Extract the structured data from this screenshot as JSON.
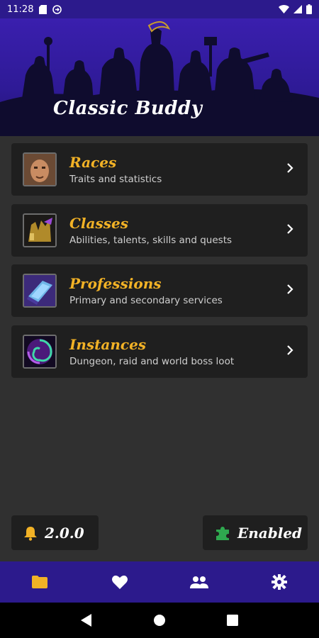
{
  "status_bar": {
    "time": "11:28"
  },
  "header": {
    "title": "Classic Buddy"
  },
  "menu": [
    {
      "title": "Races",
      "subtitle": "Traits and statistics",
      "icon": "race-portrait-icon"
    },
    {
      "title": "Classes",
      "subtitle": "Abilities, talents, skills and quests",
      "icon": "class-icon"
    },
    {
      "title": "Professions",
      "subtitle": "Primary and secondary services",
      "icon": "profession-icon"
    },
    {
      "title": "Instances",
      "subtitle": "Dungeon, raid and world boss loot",
      "icon": "instance-portal-icon"
    }
  ],
  "footer": {
    "version": "2.0.0",
    "addon_status": "Enabled"
  },
  "bottom_nav": [
    {
      "name": "folder",
      "active": true
    },
    {
      "name": "favorites",
      "active": false
    },
    {
      "name": "community",
      "active": false
    },
    {
      "name": "settings",
      "active": false
    }
  ],
  "colors": {
    "primary": "#2c1a8c",
    "accent": "#f2b226",
    "card": "#1f1f1f",
    "background": "#303030",
    "green": "#2fa84f"
  }
}
